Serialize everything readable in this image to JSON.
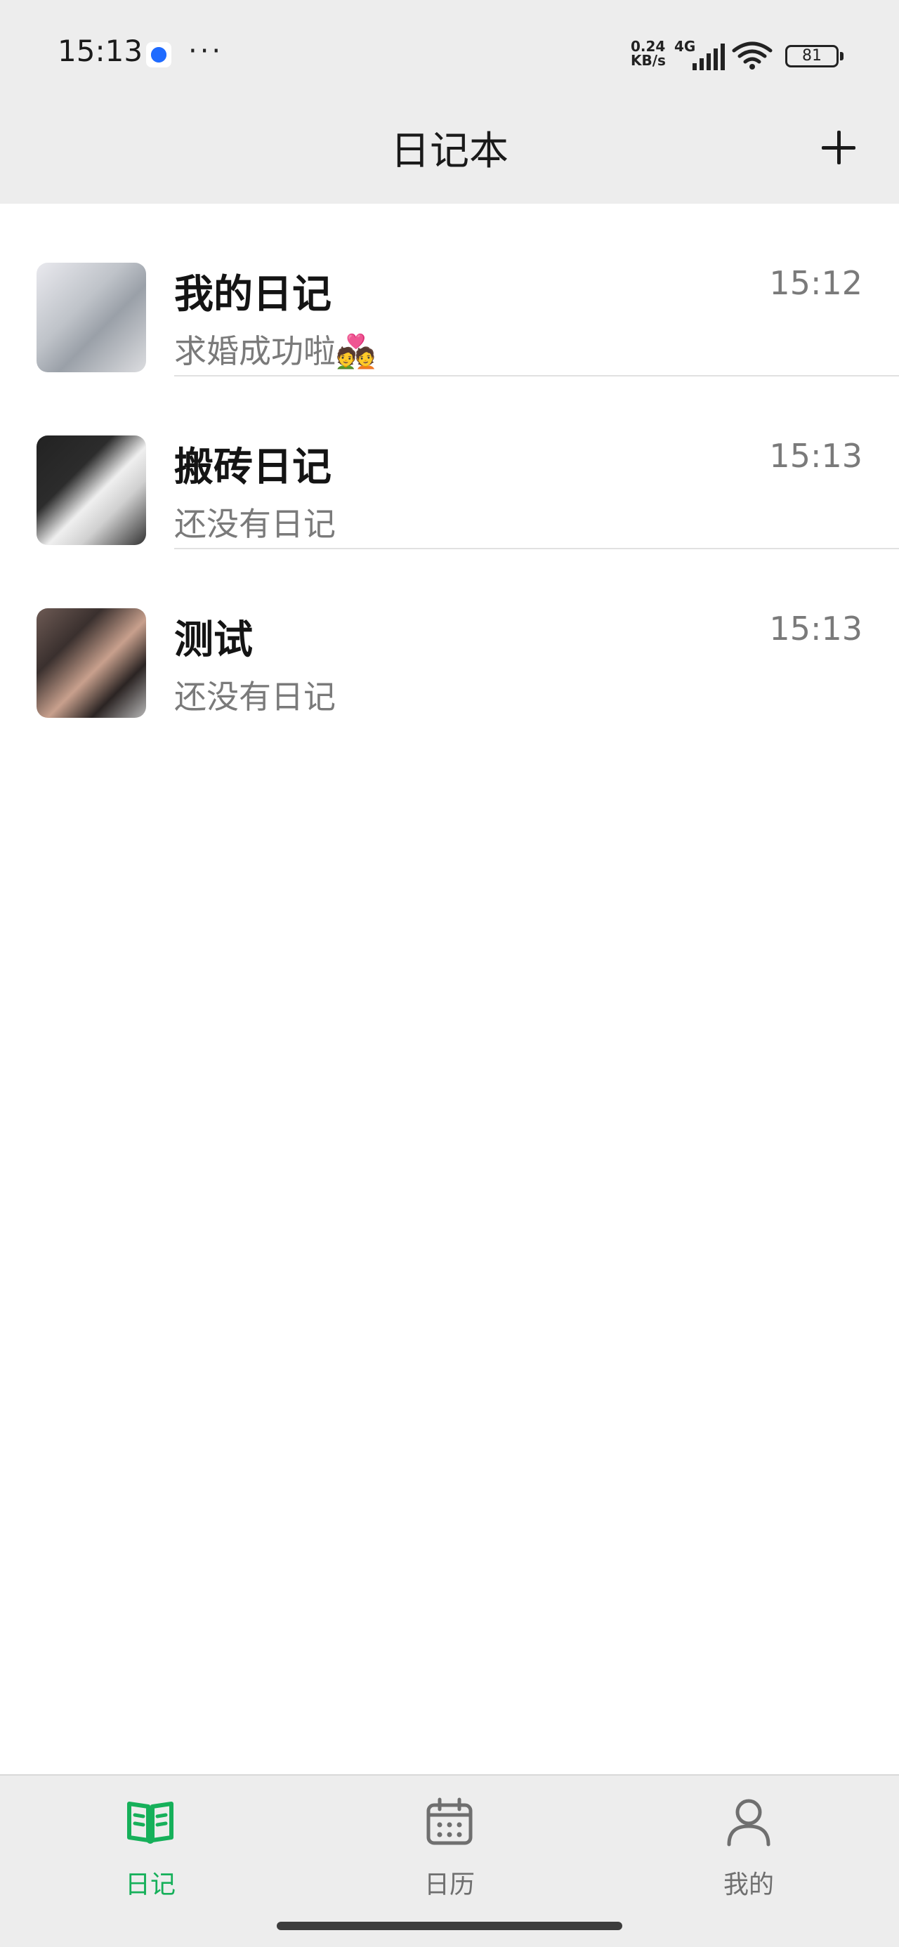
{
  "status_bar": {
    "time": "15:13",
    "more": "···",
    "net_speed_top": "0.24",
    "net_speed_bottom": "KB/s",
    "network_type": "4G",
    "battery": "81"
  },
  "header": {
    "title": "日记本",
    "add_icon": "plus-icon"
  },
  "diaries": [
    {
      "title": "我的日记",
      "subtitle": "求婚成功啦💑",
      "time": "15:12"
    },
    {
      "title": "搬砖日记",
      "subtitle": "还没有日记",
      "time": "15:13"
    },
    {
      "title": "测试",
      "subtitle": "还没有日记",
      "time": "15:13"
    }
  ],
  "bottom_nav": {
    "tabs": [
      {
        "label": "日记",
        "icon": "open-book-icon"
      },
      {
        "label": "日历",
        "icon": "calendar-icon"
      },
      {
        "label": "我的",
        "icon": "person-icon"
      }
    ]
  },
  "colors": {
    "accent": "#16b05a",
    "header_bg": "#ededed",
    "muted_text": "#7a7a7a"
  }
}
